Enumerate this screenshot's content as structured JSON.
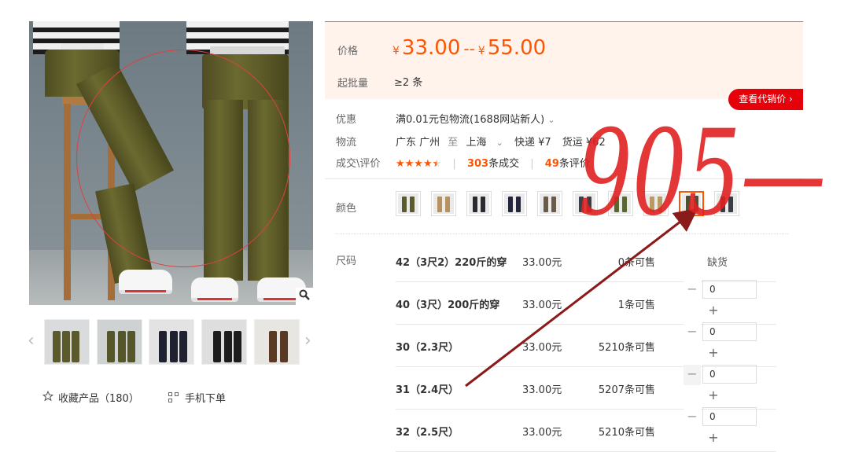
{
  "gallery": {
    "zoom_icon": "magnifier-icon",
    "thumb_prev_icon": "chevron-left-icon",
    "thumb_next_icon": "chevron-right-icon",
    "favorite_icon": "star-outline-icon",
    "favorite_label": "收藏产品（180）",
    "mobile_icon": "qr-code-icon",
    "mobile_label": "手机下单"
  },
  "price": {
    "label": "价格",
    "currency": "¥",
    "low": "33.00",
    "separator": "--",
    "high": "55.00",
    "moq_label": "起批量",
    "moq_value": "≥2 条"
  },
  "agent_button": "查看代销价 ›",
  "promo": {
    "label": "优惠",
    "text": "满0.01元包物流(1688网站新人)",
    "chevron_icon": "chevron-down-icon"
  },
  "logistics": {
    "label": "物流",
    "from": "广东 广州",
    "to_word": "至",
    "to": "上海",
    "chevron_icon": "chevron-down-icon",
    "express": "快递 ¥7",
    "freight": "货运 ¥62"
  },
  "deals": {
    "label": "成交\\评价",
    "rating_stars": 4.5,
    "deals_count": "303",
    "deals_suffix": "条成交",
    "reviews_count": "49",
    "reviews_suffix": "条评价"
  },
  "color": {
    "label": "颜色",
    "swatches": [
      "#5a5a2e",
      "#b8925e",
      "#2a2a30",
      "#23263a",
      "#6a5a48",
      "#3a4048",
      "#5b6630",
      "#b99a62",
      "#4e5036",
      "#3a3d44"
    ],
    "selected_index": 8
  },
  "size": {
    "label": "尺码",
    "rows": [
      {
        "name": "42（3尺2）220斤的穿",
        "price": "33.00元",
        "stock": "0条可售",
        "qty": "",
        "soldout": "缺货"
      },
      {
        "name": "40（3尺）200斤的穿",
        "price": "33.00元",
        "stock": "1条可售",
        "qty": "0",
        "soldout": ""
      },
      {
        "name": "30（2.3尺）",
        "price": "33.00元",
        "stock": "5210条可售",
        "qty": "0",
        "soldout": ""
      },
      {
        "name": "31（2.4尺）",
        "price": "33.00元",
        "stock": "5207条可售",
        "qty": "0",
        "soldout": ""
      },
      {
        "name": "32（2.5尺）",
        "price": "33.00元",
        "stock": "5210条可售",
        "qty": "0",
        "soldout": ""
      }
    ]
  },
  "handwriting": "905—",
  "colors": {
    "accent": "#ff5500",
    "price_bg": "#fff3ec",
    "agent_button": "#e5000a",
    "annotation_red": "#e02020",
    "arrow": "#8b1a1a"
  }
}
